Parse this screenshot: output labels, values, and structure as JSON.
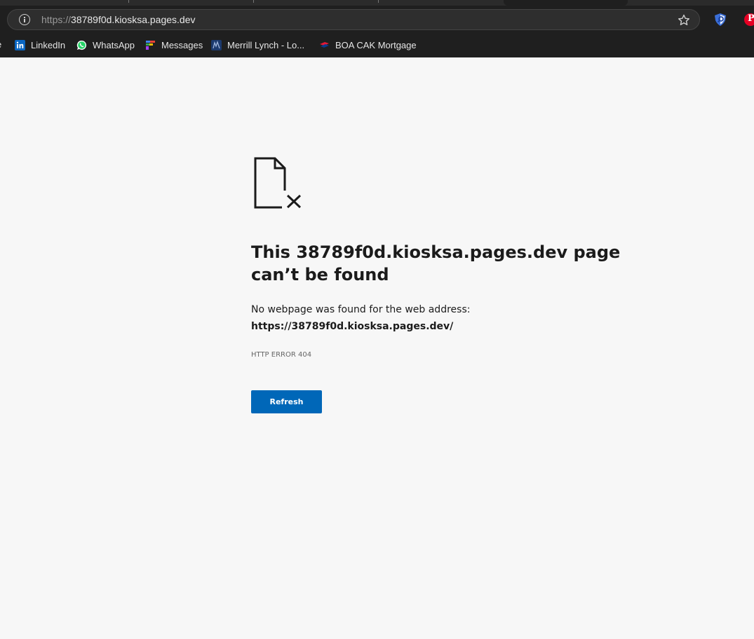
{
  "browser": {
    "url_scheme": "https://",
    "url_host": "38789f0d.kiosksa.pages.dev",
    "bookmarks": [
      {
        "label": "LinkedIn",
        "icon": "linkedin-icon"
      },
      {
        "label": "WhatsApp",
        "icon": "whatsapp-icon"
      },
      {
        "label": "Messages",
        "icon": "messages-icon"
      },
      {
        "label": "Merrill Lynch - Lo...",
        "icon": "merrill-lynch-icon"
      },
      {
        "label": "BOA CAK Mortgage",
        "icon": "bank-of-america-icon"
      }
    ],
    "partial_bookmark": "e"
  },
  "error_page": {
    "title": "This 38789f0d.kiosksa.pages.dev page can’t be found",
    "description": "No webpage was found for the web address:",
    "url": "https://38789f0d.kiosksa.pages.dev/",
    "code": "HTTP ERROR 404",
    "refresh_label": "Refresh"
  },
  "colors": {
    "accent": "#0067b8",
    "chrome_bg": "#1f1f1f",
    "page_bg": "#f7f7f7"
  }
}
